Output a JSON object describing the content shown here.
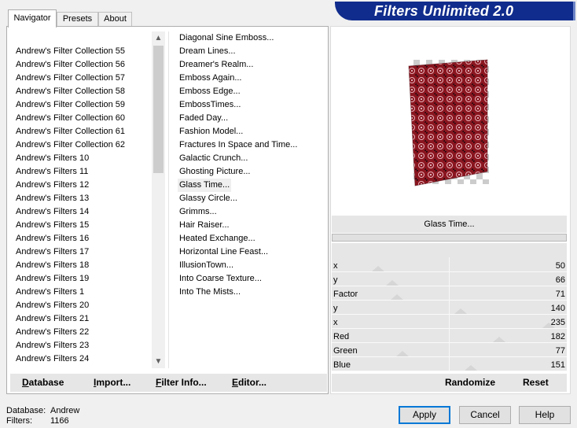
{
  "title": "Filters Unlimited 2.0",
  "tabs": [
    {
      "label": "Navigator",
      "active": true
    },
    {
      "label": "Presets",
      "active": false
    },
    {
      "label": "About",
      "active": false
    }
  ],
  "categories": [
    "Andrew's Filter Collection 55",
    "Andrew's Filter Collection 56",
    "Andrew's Filter Collection 57",
    "Andrew's Filter Collection 58",
    "Andrew's Filter Collection 59",
    "Andrew's Filter Collection 60",
    "Andrew's Filter Collection 61",
    "Andrew's Filter Collection 62",
    "Andrew's Filters 10",
    "Andrew's Filters 11",
    "Andrew's Filters 12",
    "Andrew's Filters 13",
    "Andrew's Filters 14",
    "Andrew's Filters 15",
    "Andrew's Filters 16",
    "Andrew's Filters 17",
    "Andrew's Filters 18",
    "Andrew's Filters 19",
    "Andrew's Filters 1",
    "Andrew's Filters 20",
    "Andrew's Filters 21",
    "Andrew's Filters 22",
    "Andrew's Filters 23",
    "Andrew's Filters 24"
  ],
  "filters": [
    "Diagonal Sine Emboss...",
    "Dream Lines...",
    "Dreamer's Realm...",
    "Emboss Again...",
    "Emboss Edge...",
    "EmbossTimes...",
    "Faded Day...",
    "Fashion Model...",
    "Fractures In Space and Time...",
    "Galactic Crunch...",
    "Ghosting Picture...",
    "Glass Time...",
    "Glassy Circle...",
    "Grimms...",
    "Hair Raiser...",
    "Heated Exchange...",
    "Horizontal Line Feast...",
    "IllusionTown...",
    "Into Coarse Texture...",
    "Into The Mists..."
  ],
  "selected_filter_index": 11,
  "left_buttons": {
    "database": {
      "underline": "D",
      "rest": "atabase"
    },
    "import": {
      "underline": "I",
      "rest": "mport..."
    },
    "filter_info": {
      "underline": "F",
      "rest": "ilter Info..."
    },
    "editor": {
      "underline": "E",
      "rest": "ditor..."
    }
  },
  "preview": {
    "filter_name": "Glass Time..."
  },
  "params": [
    {
      "name": "x",
      "value": "50",
      "max": 255
    },
    {
      "name": "y",
      "value": "66",
      "max": 255
    },
    {
      "name": "Factor",
      "value": "71",
      "max": 255
    },
    {
      "name": "y",
      "value": "140",
      "max": 255
    },
    {
      "name": "x",
      "value": "235",
      "max": 255
    },
    {
      "name": "Red",
      "value": "182",
      "max": 255
    },
    {
      "name": "Green",
      "value": "77",
      "max": 255
    },
    {
      "name": "Blue",
      "value": "151",
      "max": 255
    }
  ],
  "right_buttons": {
    "randomize": "Randomize",
    "reset": "Reset"
  },
  "info": {
    "database_label": "Database:",
    "database_value": "Andrew",
    "filters_label": "Filters:",
    "filters_value": "1166"
  },
  "dialog_buttons": {
    "apply": "Apply",
    "cancel": "Cancel",
    "help": "Help"
  },
  "colors": {
    "banner": "#102c8c",
    "selection": "#efefef",
    "accent": "#0078d7"
  }
}
